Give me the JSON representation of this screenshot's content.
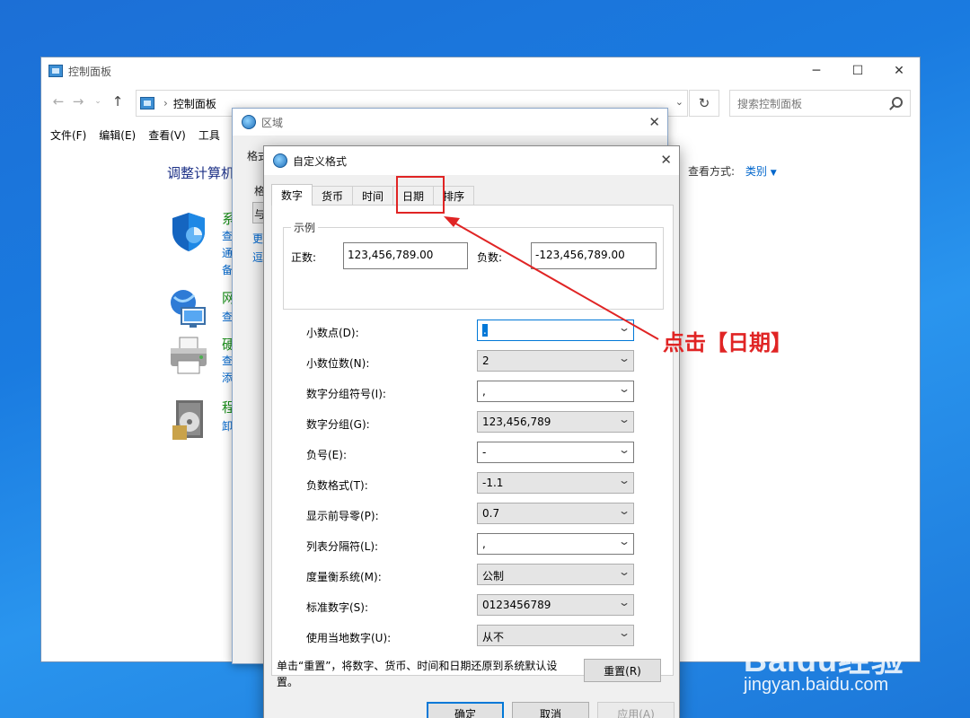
{
  "control_panel": {
    "title": "控制面板",
    "breadcrumb": "控制面板",
    "search_placeholder": "搜索控制面板",
    "menu": [
      "文件(F)",
      "编辑(E)",
      "查看(V)",
      "工具"
    ],
    "heading": "调整计算机",
    "view_by_label": "查看方式:",
    "view_by_value": "类别",
    "categories": [
      {
        "title": "系",
        "links": [
          "查",
          "通",
          "备"
        ]
      },
      {
        "title": "网",
        "links": [
          "查"
        ]
      },
      {
        "title": "硬",
        "links": [
          "查",
          "添"
        ]
      },
      {
        "title": "程",
        "links": [
          "卸"
        ]
      }
    ]
  },
  "region_dialog": {
    "title": "区域",
    "fragments": [
      "格式",
      "格",
      "与",
      "更",
      "逗"
    ]
  },
  "custom_format": {
    "title": "自定义格式",
    "tabs": [
      "数字",
      "货币",
      "时间",
      "日期",
      "排序"
    ],
    "active_tab": "数字",
    "example": {
      "group_label": "示例",
      "positive_label": "正数:",
      "positive_value": "123,456,789.00",
      "negative_label": "负数:",
      "negative_value": "-123,456,789.00"
    },
    "rows": [
      {
        "label": "小数点(D):",
        "value": "."
      },
      {
        "label": "小数位数(N):",
        "value": "2"
      },
      {
        "label": "数字分组符号(I):",
        "value": ","
      },
      {
        "label": "数字分组(G):",
        "value": "123,456,789"
      },
      {
        "label": "负号(E):",
        "value": "-"
      },
      {
        "label": "负数格式(T):",
        "value": "-1.1"
      },
      {
        "label": "显示前导零(P):",
        "value": "0.7"
      },
      {
        "label": "列表分隔符(L):",
        "value": ","
      },
      {
        "label": "度量衡系统(M):",
        "value": "公制"
      },
      {
        "label": "标准数字(S):",
        "value": "0123456789"
      },
      {
        "label": "使用当地数字(U):",
        "value": "从不"
      }
    ],
    "reset_description": "单击“重置”，将数字、货币、时间和日期还原到系统默认设置。",
    "reset_button": "重置(R)",
    "ok_button": "确定",
    "cancel_button": "取消",
    "apply_button": "应用(A)"
  },
  "annotation": {
    "text": "点击【日期】",
    "color": "#e02424"
  },
  "watermark": {
    "logo": "Baidu经验",
    "url": "jingyan.baidu.com"
  }
}
